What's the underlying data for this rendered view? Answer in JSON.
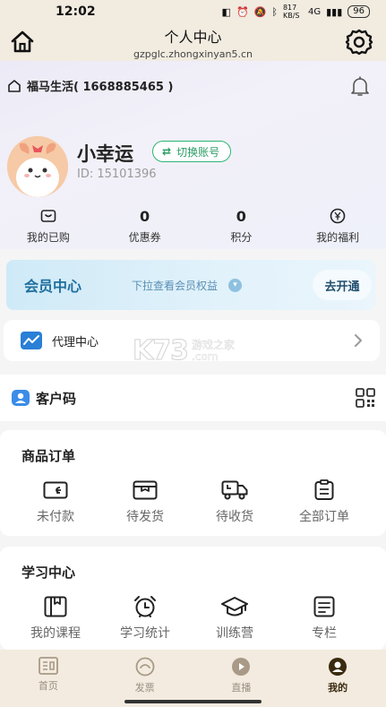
{
  "status_bar": {
    "time": "12:02",
    "net_speed": "817 KB/S",
    "signal": "4G",
    "battery": "96"
  },
  "title_bar": {
    "title": "个人中心",
    "url": "gzpglc.zhongxinyan5.cn"
  },
  "shop": {
    "name": "福马生活( 1668885465 )"
  },
  "profile": {
    "username": "小幸运",
    "switch_account": "切换账号",
    "user_id": "ID: 15101396"
  },
  "stats": [
    {
      "value": "",
      "label": "我的已购",
      "icon": "wallet-icon"
    },
    {
      "value": "0",
      "label": "优惠券"
    },
    {
      "value": "0",
      "label": "积分"
    },
    {
      "value": "",
      "label": "我的福利",
      "icon": "yuan-coin-icon"
    }
  ],
  "vip": {
    "title": "会员中心",
    "tip": "下拉查看会员权益",
    "button": "去开通"
  },
  "agent": {
    "label": "代理中心"
  },
  "watermark": {
    "brand": "K73",
    "line1": "游戏之家",
    "line2": ".com"
  },
  "customer_code": {
    "label": "客户码"
  },
  "orders": {
    "title": "商品订单",
    "items": [
      {
        "label": "未付款",
        "icon": "card-icon"
      },
      {
        "label": "待发货",
        "icon": "box-icon"
      },
      {
        "label": "待收货",
        "icon": "truck-icon"
      },
      {
        "label": "全部订单",
        "icon": "clipboard-icon"
      }
    ]
  },
  "study": {
    "title": "学习中心",
    "items": [
      {
        "label": "我的课程",
        "icon": "book-icon"
      },
      {
        "label": "学习统计",
        "icon": "alarm-clock-icon"
      },
      {
        "label": "训练营",
        "icon": "graduation-cap-icon"
      },
      {
        "label": "专栏",
        "icon": "column-icon"
      }
    ]
  },
  "tabs": [
    {
      "label": "首页",
      "icon": "home-tab-icon",
      "active": false
    },
    {
      "label": "发票",
      "icon": "invoice-tab-icon",
      "active": false
    },
    {
      "label": "直播",
      "icon": "live-tab-icon",
      "active": false
    },
    {
      "label": "我的",
      "icon": "profile-tab-icon",
      "active": true
    }
  ],
  "colors": {
    "accent_green": "#2bb673",
    "vip_blue": "#1f6f9f",
    "tab_bar_bg": "#f3ebdf"
  }
}
